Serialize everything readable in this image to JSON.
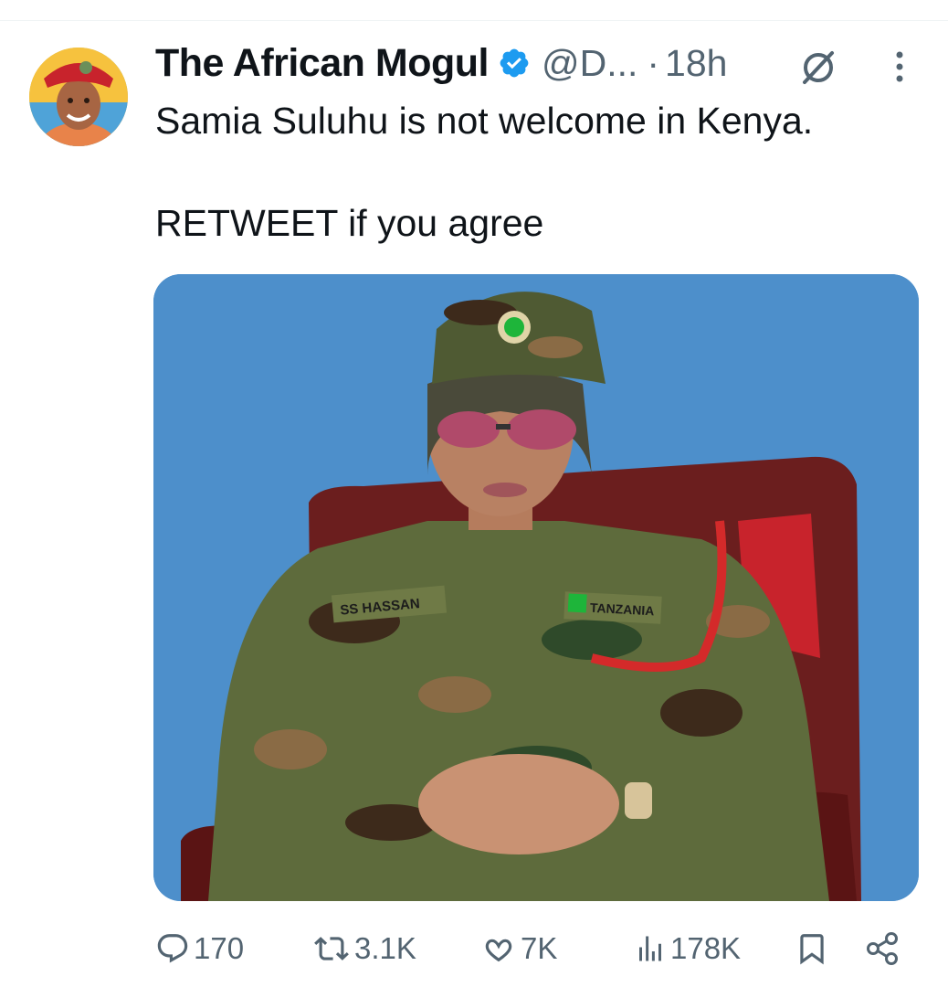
{
  "tweet": {
    "author_name": "The African Mogul",
    "handle": "@D...",
    "separator": "·",
    "time": "18h",
    "text_line1": "Samia Suluhu is not welcome in Kenya.",
    "text_line2": "RETWEET if you agree"
  },
  "media": {
    "name_tape": "SS HASSAN",
    "flag_tape": "TANZANIA"
  },
  "actions": {
    "replies": "170",
    "retweets": "3.1K",
    "likes": "7K",
    "views": "178K"
  },
  "colors": {
    "verified": "#1d9bf0",
    "muted": "#536471",
    "media_background": "#4d8fcb"
  },
  "icons": [
    "verified-badge-icon",
    "grok-icon",
    "more-icon",
    "reply-icon",
    "retweet-icon",
    "like-icon",
    "views-icon",
    "bookmark-icon",
    "share-icon"
  ]
}
